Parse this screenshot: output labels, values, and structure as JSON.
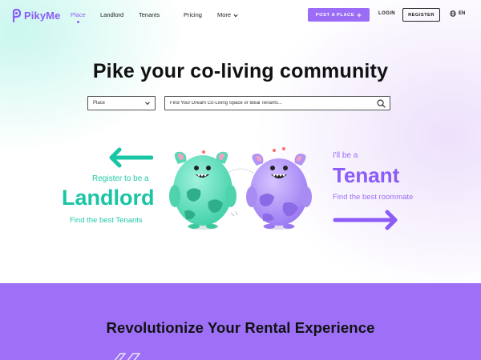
{
  "brand": {
    "name": "PikyMe",
    "color": "#8b5cf6"
  },
  "nav": {
    "links": [
      {
        "label": "Place",
        "active": true
      },
      {
        "label": "Landlord",
        "active": false
      },
      {
        "label": "Tenants",
        "active": false
      },
      {
        "label": "Pricing",
        "active": false
      },
      {
        "label": "More",
        "active": false,
        "has_dropdown": true
      }
    ],
    "post_button": "POST A PLACE",
    "post_button_icon": "plus-icon",
    "login": "LOGIN",
    "register": "REGISTER",
    "language": "EN",
    "language_icon": "globe-icon"
  },
  "hero": {
    "headline": "Pike your co-living community",
    "select": {
      "value": "Place"
    },
    "search": {
      "placeholder": "Find Your Dream Co-Living Space or Ideal Tenants..."
    },
    "landlord": {
      "pre": "Register to be a",
      "title": "Landlord",
      "sub": "Find the best Tenants",
      "color": "#18c5a4"
    },
    "tenant": {
      "pre": "I'll be a",
      "title": "Tenant",
      "sub": "Find the best roommate",
      "color": "#8b5cf6"
    }
  },
  "band": {
    "title": "Revolutionize Your Rental Experience",
    "color": "#9d70f7"
  }
}
